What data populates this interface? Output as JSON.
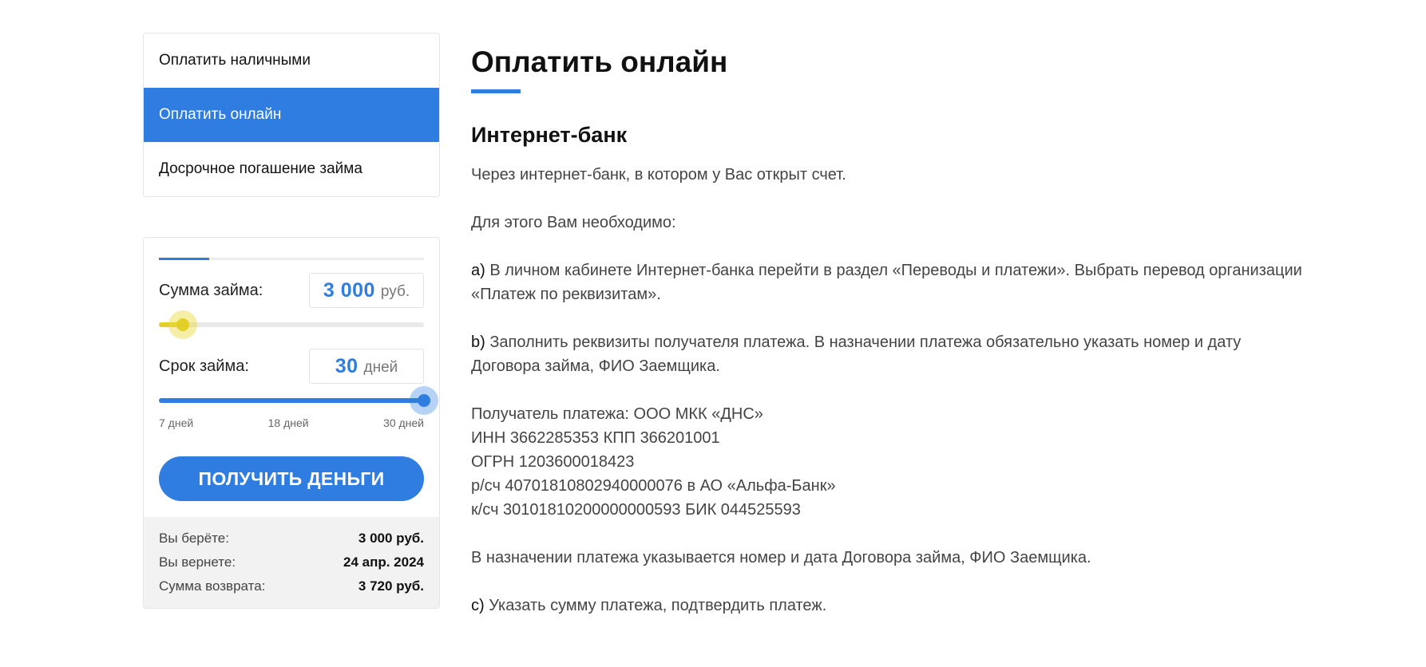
{
  "sidebar": {
    "menu": [
      {
        "label": "Оплатить наличными",
        "active": false
      },
      {
        "label": "Оплатить онлайн",
        "active": true
      },
      {
        "label": "Досрочное погашение займа",
        "active": false
      }
    ]
  },
  "calculator": {
    "amount": {
      "label": "Сумма займа:",
      "value": "3 000",
      "unit": "руб.",
      "slider_fraction": 0.09
    },
    "term": {
      "label": "Срок займа:",
      "value": "30",
      "unit": "дней",
      "slider_fraction": 1.0,
      "ticks": [
        "7 дней",
        "18 дней",
        "30 дней"
      ]
    },
    "button_label": "ПОЛУЧИТЬ ДЕНЬГИ",
    "summary": [
      {
        "label": "Вы берёте:",
        "value": "3 000 руб."
      },
      {
        "label": "Вы вернете:",
        "value": "24 апр. 2024"
      },
      {
        "label": "Сумма возврата:",
        "value": "3 720 руб."
      }
    ]
  },
  "content": {
    "title": "Оплатить онлайн",
    "subtitle": "Интернет-банк",
    "intro": "Через интернет-банк, в котором у Вас открыт счет.",
    "need": "Для этого Вам необходимо:",
    "step_a": {
      "marker": "a)",
      "text": " В личном кабинете Интернет-банка перейти в раздел «Переводы и платежи». Выбрать перевод организации «Платеж по реквизитам»."
    },
    "step_b": {
      "marker": "b)",
      "text": " Заполнить реквизиты получателя платежа. В назначении платежа обязательно указать номер и дату Договора займа, ФИО Заемщика."
    },
    "recipient": [
      "Получатель платежа: ООО МКК «ДНС»",
      "ИНН 3662285353 КПП 366201001",
      "ОГРН 1203600018423",
      "р/сч 40701810802940000076 в АО «Альфа-Банк»",
      "к/сч 30101810200000000593 БИК 044525593"
    ],
    "purpose": "В назначении платежа указывается номер и дата Договора займа, ФИО Заемщика.",
    "step_c": {
      "marker": "c)",
      "text": " Указать сумму платежа, подтвердить платеж."
    }
  },
  "colors": {
    "accent": "#2f7de1",
    "slider_amount": "#e2d028",
    "summary_bg": "#f2f2f2"
  }
}
